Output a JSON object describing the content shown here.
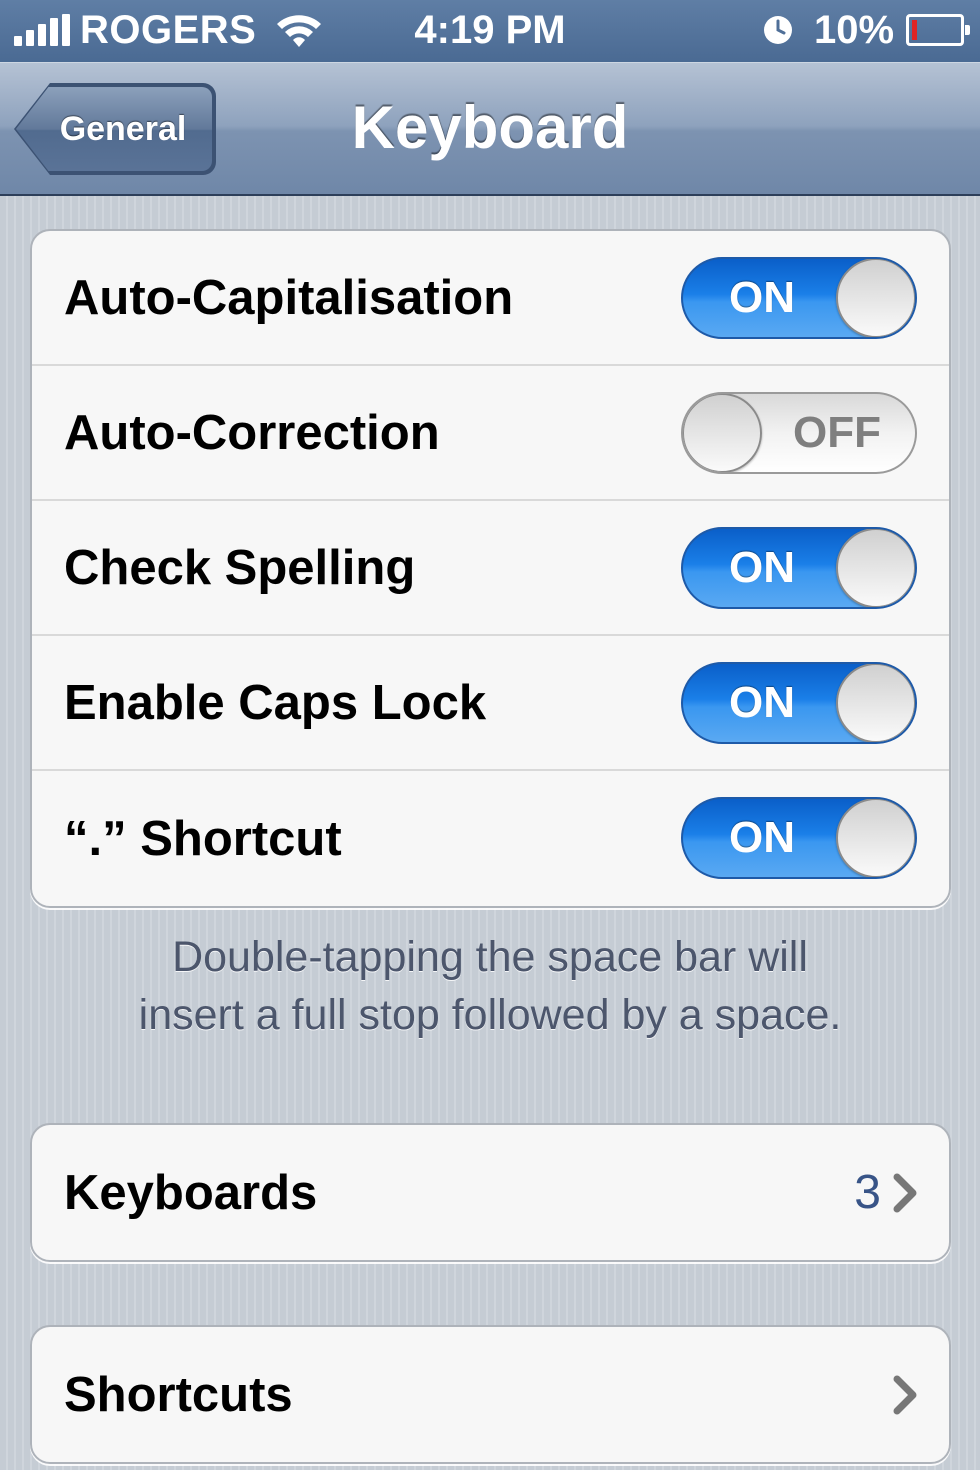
{
  "status_bar": {
    "carrier": "ROGERS",
    "time": "4:19 PM",
    "battery_percent": "10%",
    "battery_level": 0.1,
    "icons": [
      "signal-icon",
      "wifi-icon",
      "alarm-icon",
      "battery-icon"
    ]
  },
  "nav_bar": {
    "back_label": "General",
    "title": "Keyboard"
  },
  "settings": {
    "toggles": [
      {
        "label": "Auto-Capitalisation",
        "state": "ON"
      },
      {
        "label": "Auto-Correction",
        "state": "OFF"
      },
      {
        "label": "Check Spelling",
        "state": "ON"
      },
      {
        "label": "Enable Caps Lock",
        "state": "ON"
      },
      {
        "label": "“.” Shortcut",
        "state": "ON"
      }
    ],
    "footer_note_line1": "Double-tapping the space bar will",
    "footer_note_line2": "insert a full stop followed by a space."
  },
  "keyboards": {
    "label": "Keyboards",
    "count": "3"
  },
  "shortcuts": {
    "label": "Shortcuts"
  },
  "colors": {
    "toggle_on": "#1a7fe8",
    "nav_bar": "#7d93b1",
    "detail_value": "#385487"
  }
}
